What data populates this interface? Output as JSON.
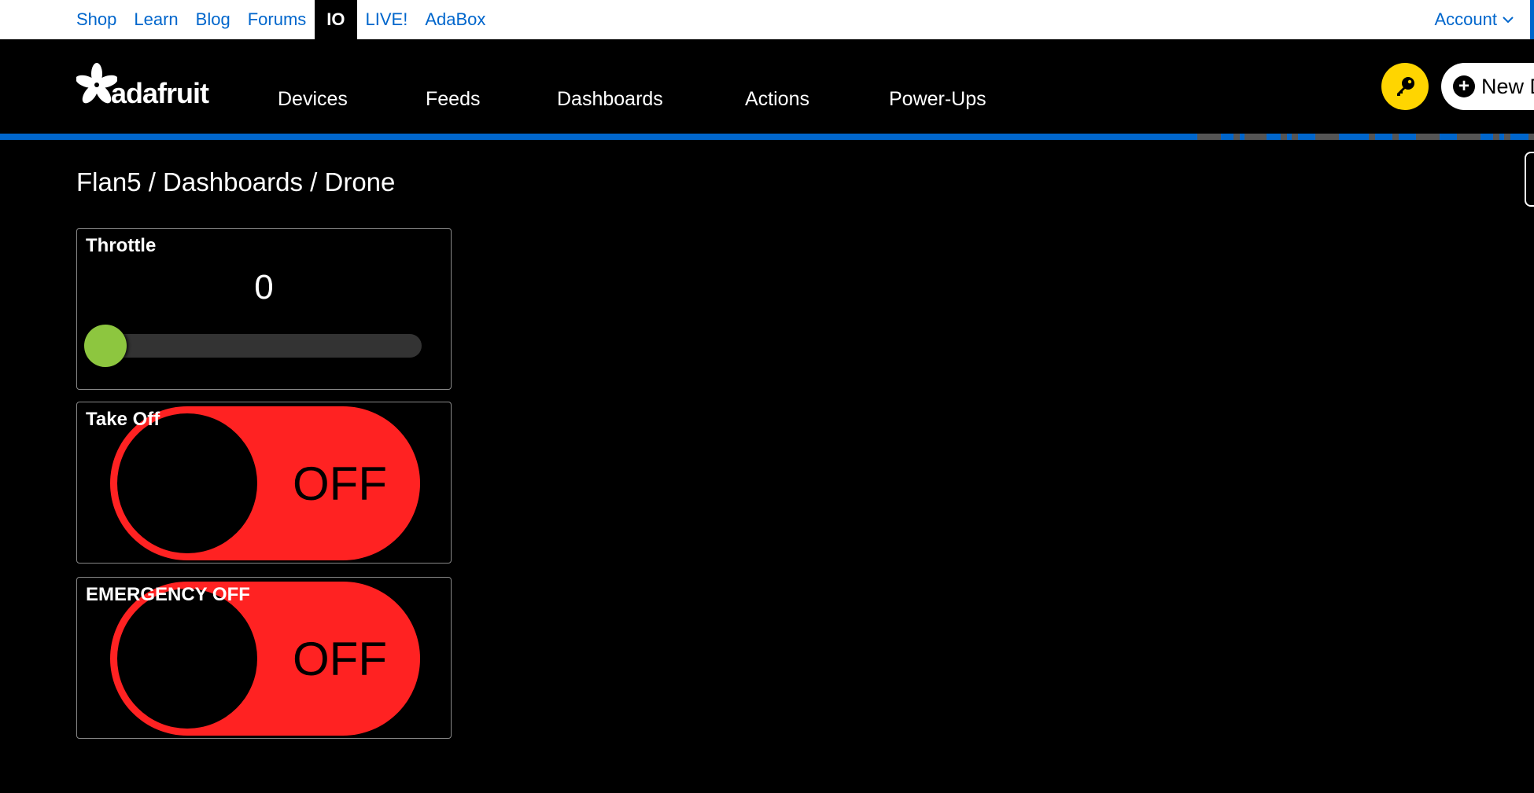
{
  "topbar": {
    "links": [
      {
        "label": "Shop",
        "active": false
      },
      {
        "label": "Learn",
        "active": false
      },
      {
        "label": "Blog",
        "active": false
      },
      {
        "label": "Forums",
        "active": false
      },
      {
        "label": "IO",
        "active": true
      },
      {
        "label": "LIVE!",
        "active": false
      },
      {
        "label": "AdaBox",
        "active": false
      }
    ],
    "account_label": "Account",
    "account_icon": "chevron-down-icon"
  },
  "header": {
    "logo_text": "adafruit",
    "logo_icon": "flower-star-icon",
    "nav": [
      {
        "label": "Devices"
      },
      {
        "label": "Feeds"
      },
      {
        "label": "Dashboards"
      },
      {
        "label": "Actions"
      },
      {
        "label": "Power-Ups"
      }
    ],
    "key_button_icon": "key-icon",
    "new_button_label": "New D",
    "new_button_icon": "plus-circle-icon"
  },
  "colors": {
    "link_blue": "#0066cc",
    "key_yellow": "#ffd500",
    "slider_green": "#8dc63f",
    "toggle_red": "#ff2222"
  },
  "breadcrumb": {
    "text": "Flan5 / Dashboards / Drone",
    "parts": [
      "Flan5",
      "Dashboards",
      "Drone"
    ]
  },
  "blocks": [
    {
      "type": "slider",
      "title": "Throttle",
      "value": "0",
      "fraction": 0
    },
    {
      "type": "toggle",
      "title": "Take Off",
      "state": "OFF",
      "on": false
    },
    {
      "type": "toggle",
      "title": "EMERGENCY OFF",
      "state": "OFF",
      "on": false
    }
  ]
}
